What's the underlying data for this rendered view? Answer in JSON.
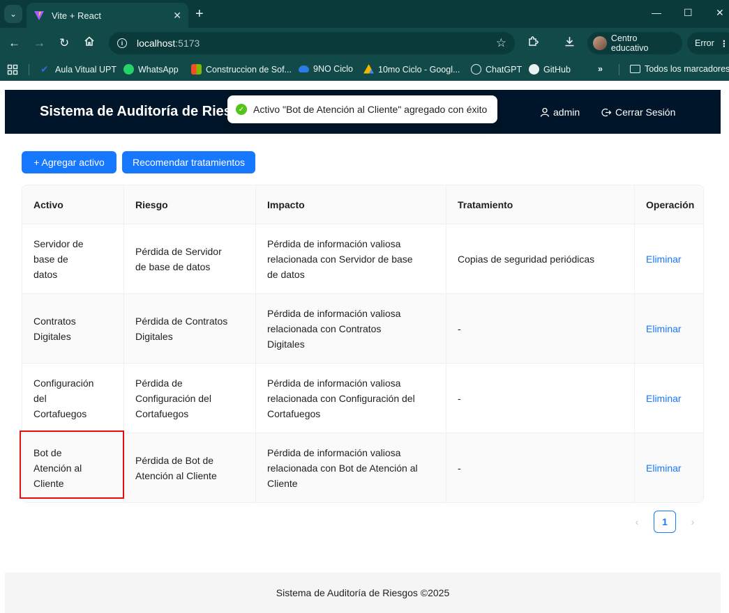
{
  "browser": {
    "tab_title": "Vite + React",
    "url_host": "localhost",
    "url_port": ":5173",
    "profile_label": "Centro educativo",
    "error_label": "Error",
    "bookmarks": [
      {
        "label": "Aula Vitual UPT",
        "icon": "check-icon",
        "color": "#2b6cd9"
      },
      {
        "label": "WhatsApp",
        "icon": "whatsapp-icon",
        "color": "#25d366"
      },
      {
        "label": "Construccion de Sof...",
        "icon": "microsoft-icon",
        "color": "#f25022"
      },
      {
        "label": "9NO Ciclo",
        "icon": "onedrive-icon",
        "color": "#2c7be5"
      },
      {
        "label": "10mo Ciclo - Googl...",
        "icon": "drive-icon",
        "color": "#f4b400"
      },
      {
        "label": "ChatGPT",
        "icon": "chatgpt-icon",
        "color": "#e8f2f2"
      },
      {
        "label": "GitHub",
        "icon": "github-icon",
        "color": "#e8f2f2"
      }
    ],
    "all_bookmarks_label": "Todos los marcadores",
    "more_label": "»"
  },
  "header": {
    "title": "Sistema de Auditoría de Riesgos",
    "user_label": "admin",
    "logout_label": "Cerrar Sesión"
  },
  "toast": {
    "message": "Activo \"Bot de Atención al Cliente\" agregado con éxito"
  },
  "actions": {
    "add_label": "+ Agregar activo",
    "recommend_label": "Recomendar tratamientos"
  },
  "table": {
    "columns": [
      "Activo",
      "Riesgo",
      "Impacto",
      "Tratamiento",
      "Operación"
    ],
    "rows": [
      {
        "activo": "Servidor de base de datos",
        "riesgo": "Pérdida de Servidor de base de datos",
        "impacto": "Pérdida de información valiosa relacionada con Servidor de base de datos",
        "tratamiento": "Copias de seguridad periódicas",
        "operacion": "Eliminar"
      },
      {
        "activo": "Contratos Digitales",
        "riesgo": "Pérdida de Contratos Digitales",
        "impacto": "Pérdida de información valiosa relacionada con Contratos Digitales",
        "tratamiento": "-",
        "operacion": "Eliminar"
      },
      {
        "activo": "Configuración del Cortafuegos",
        "riesgo": "Pérdida de Configuración del Cortafuegos",
        "impacto": "Pérdida de información valiosa relacionada con Configuración del Cortafuegos",
        "tratamiento": "-",
        "operacion": "Eliminar"
      },
      {
        "activo": "Bot de Atención al Cliente",
        "riesgo": "Pérdida de Bot de Atención al Cliente",
        "impacto": "Pérdida de información valiosa relacionada con Bot de Atención al Cliente",
        "tratamiento": "-",
        "operacion": "Eliminar"
      }
    ]
  },
  "pagination": {
    "prev": "‹",
    "current": "1",
    "next": "›"
  },
  "footer": {
    "text": "Sistema de Auditoría de Riesgos ©2025"
  }
}
